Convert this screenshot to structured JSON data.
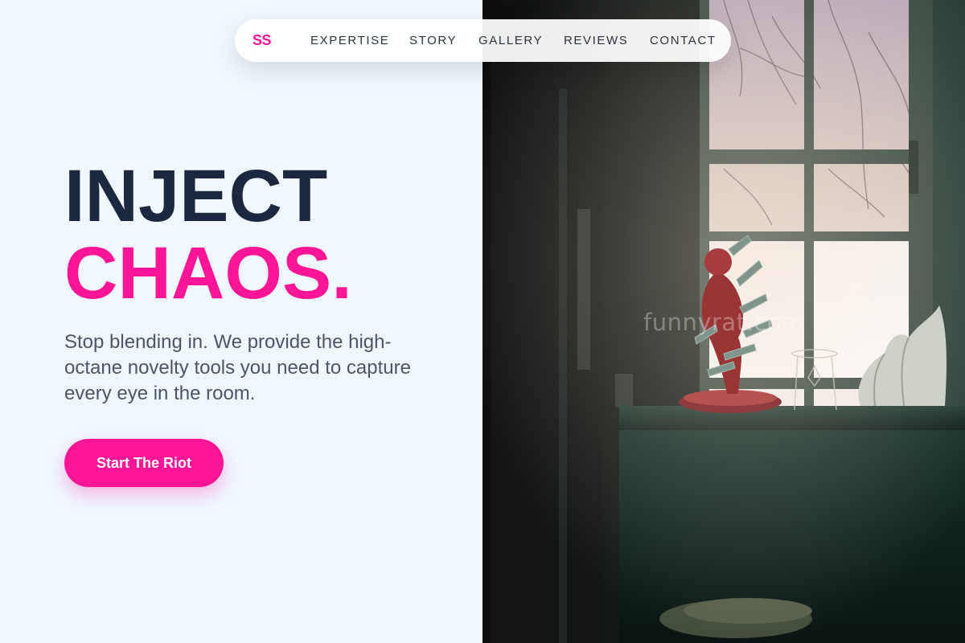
{
  "nav": {
    "logo": "SS",
    "items": [
      {
        "label": "EXPERTISE"
      },
      {
        "label": "STORY"
      },
      {
        "label": "GALLERY"
      },
      {
        "label": "REVIEWS"
      },
      {
        "label": "CONTACT"
      }
    ]
  },
  "hero": {
    "headline_line1": "INJECT",
    "headline_line2": "CHAOS.",
    "subtext": "Stop blending in. We provide the high-octane novelty tools you need to capture every eye in the room.",
    "cta_label": "Start The Riot",
    "watermark": "funnyrat.com"
  },
  "colors": {
    "accent": "#ff1596",
    "headline_dark": "#1c2840",
    "background": "#f0f7ff"
  }
}
